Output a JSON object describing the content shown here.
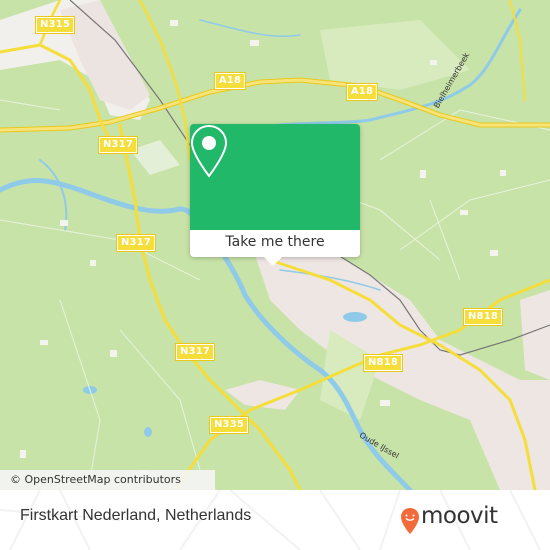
{
  "map": {
    "road_labels": [
      {
        "id": "n315",
        "text": "N315"
      },
      {
        "id": "a18-west",
        "text": "A18"
      },
      {
        "id": "a18-east",
        "text": "A18"
      },
      {
        "id": "n317-north",
        "text": "N317"
      },
      {
        "id": "n317-mid",
        "text": "N317"
      },
      {
        "id": "n317-south",
        "text": "N317"
      },
      {
        "id": "n335",
        "text": "N335"
      },
      {
        "id": "n818-east",
        "text": "N818"
      },
      {
        "id": "n818-mid",
        "text": "N818"
      }
    ],
    "water_labels": [
      {
        "id": "bielheimerbeek",
        "text": "Bielheimerbeek"
      },
      {
        "id": "oude-ijssel",
        "text": "Oude IJssel"
      }
    ],
    "attribution": "© OpenStreetMap contributors",
    "colors": {
      "land": "#c8e3a8",
      "urban": "#eee6e2",
      "water": "#8fcbe8",
      "road": "#f5dd3a",
      "rail": "#777777"
    }
  },
  "popup": {
    "pin_icon": "map-pin-icon",
    "action_label": "Take me there",
    "accent_color": "#21b86a"
  },
  "footer": {
    "place_name": "Firstkart Nederland, Netherlands",
    "brand_name": "moovit",
    "brand_color": "#f26b3a"
  }
}
